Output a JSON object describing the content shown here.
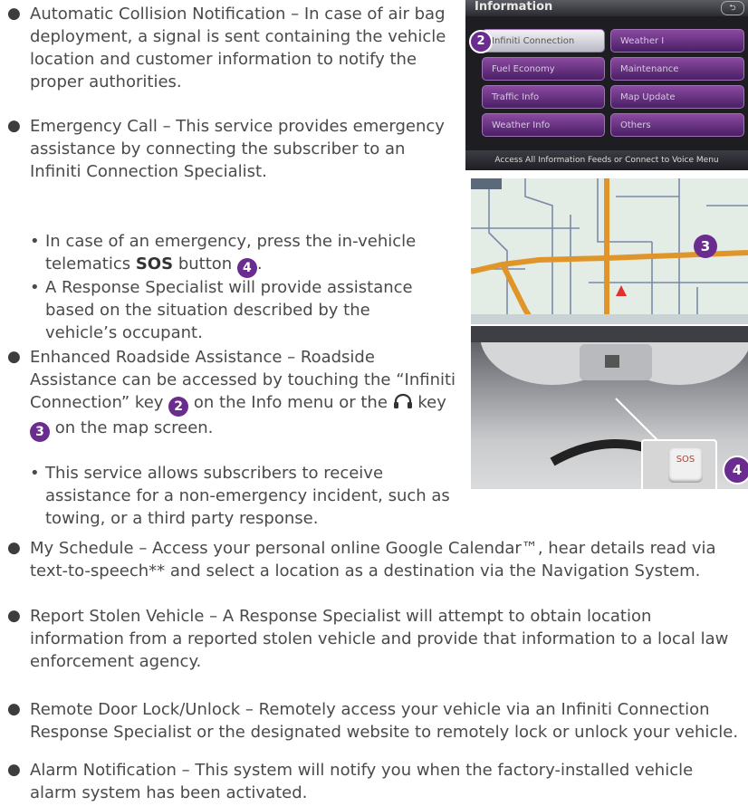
{
  "bullet": "●",
  "sub_bullet": "•",
  "items": {
    "acn": "Automatic Collision Notification – In case of air bag deployment, a signal is sent containing the vehicle location and customer information to notify the proper authorities.",
    "emergency": "Emergency Call – This service provides emergency assistance by connecting the subscriber to an Infiniti Connection Specialist.",
    "em_sub1_pre": "In case of an emergency, press the in-vehicle telematics",
    "em_sub1_bold": "SOS",
    "em_sub1_post": "button",
    "em_sub2": "A Response Specialist will provide assistance based on the situation described by the vehicle’s occupant.",
    "roadside_pre": "Enhanced Roadside Assistance – Roadside Assistance can be accessed by touching the “Infiniti Connection” key",
    "roadside_mid": "on the Info menu or the",
    "roadside_key": "key",
    "roadside_post": "on the map screen.",
    "rs_sub1": "This service allows subscribers to receive assistance for a non-emergency incident, such as towing, or a third party response.",
    "schedule": "My Schedule – Access your personal online Google Calendar™, hear details read via text-to-speech** and select a location as a destination via the Navigation System.",
    "stolen": "Report Stolen Vehicle – A Response Specialist will attempt to obtain location information from a reported stolen vehicle and provide that information to a local law enforcement agency.",
    "door": "Remote Door Lock/Unlock – Remotely access your vehicle via an Infiniti Connection Response Specialist or the designated website to remotely lock or unlock your vehicle.",
    "alarm": "Alarm Notification – This system will notify you when the factory-installed vehicle alarm system has been activated."
  },
  "badges": {
    "two": "2",
    "three": "3",
    "four": "4"
  },
  "screen": {
    "title": "Information",
    "back": "⮌",
    "buttons": [
      "Infiniti Connection",
      "Weather I",
      "Fuel Economy",
      "Maintenance",
      "Traffic Info",
      "Map Update",
      "Weather Info",
      "Others"
    ],
    "footer": "Access All Information Feeds or Connect to Voice Menu"
  },
  "car": {
    "sos_label": "SOS"
  },
  "colors": {
    "badge": "#6a2c8f",
    "text": "#4a4a4a",
    "road": "#e0952a"
  },
  "icons": {
    "headset": "headset-icon"
  }
}
